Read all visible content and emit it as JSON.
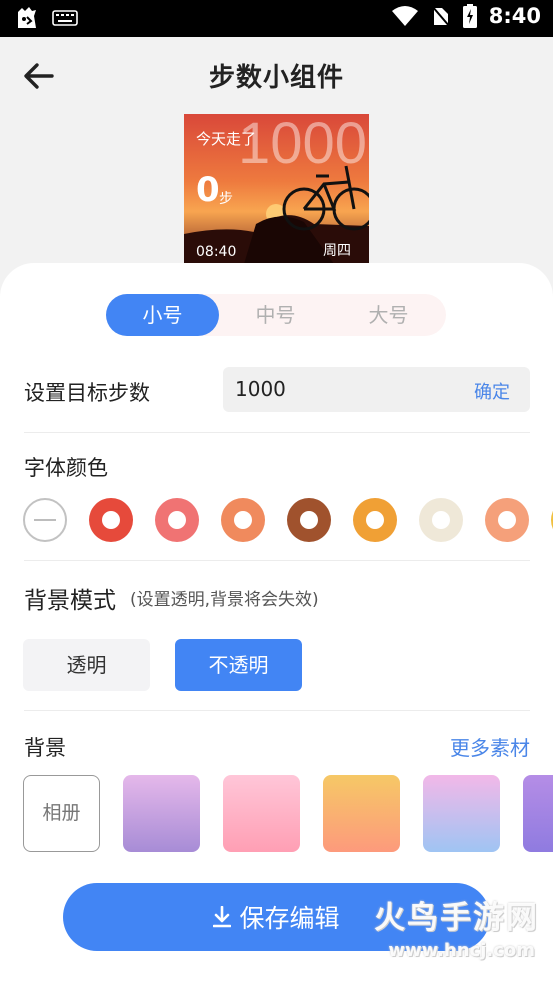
{
  "status_bar": {
    "time": "8:40"
  },
  "header": {
    "title": "步数小组件"
  },
  "preview": {
    "today_label": "今天走了",
    "goal_watermark": "1000",
    "steps": "0",
    "steps_unit": "步",
    "time": "08:40",
    "weekday": "周四"
  },
  "size_tabs": [
    {
      "label": "小号",
      "active": true
    },
    {
      "label": "中号",
      "active": false
    },
    {
      "label": "大号",
      "active": false
    }
  ],
  "goal": {
    "label": "设置目标步数",
    "value": "1000",
    "confirm": "确定"
  },
  "font_color": {
    "label": "字体颜色",
    "swatches": [
      "none",
      "#e64a3b",
      "#f07373",
      "#f08a5d",
      "#a0522d",
      "#f0a035",
      "#efe8d8",
      "#f5a07a",
      "#f0c040"
    ]
  },
  "bg_mode": {
    "title": "背景模式",
    "note": "(设置透明,背景将会失效)",
    "options": [
      {
        "label": "透明",
        "active": false
      },
      {
        "label": "不透明",
        "active": true
      }
    ]
  },
  "background": {
    "label": "背景",
    "more": "更多素材",
    "album": "相册",
    "gradients": [
      [
        "#e5b8ea",
        "#a78cd6"
      ],
      [
        "#ffc6d8",
        "#ff9fb4"
      ],
      [
        "#f6c866",
        "#fd9a7c"
      ],
      [
        "#f2b8e8",
        "#9fc4f3"
      ],
      [
        "#b58de6",
        "#8f7be0"
      ]
    ]
  },
  "save": {
    "label": "保存编辑"
  },
  "watermark": {
    "text": "火鸟手游网",
    "url": "www.hncj.com"
  },
  "colors": {
    "accent": "#4285f4",
    "link": "#4a86e8"
  }
}
